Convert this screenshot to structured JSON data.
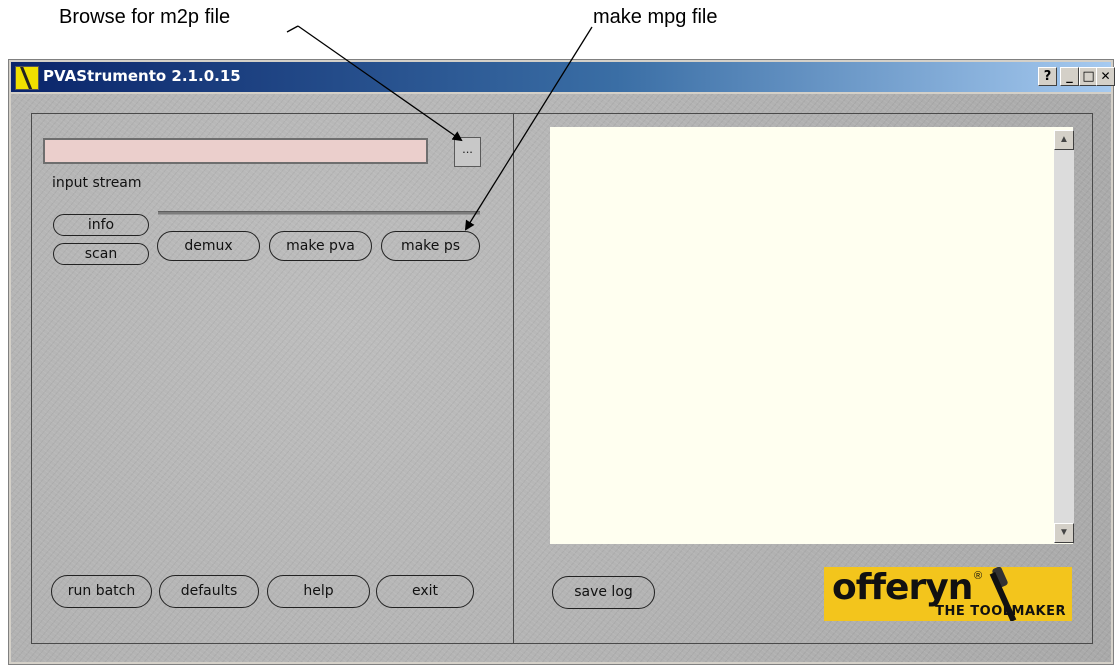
{
  "annotations": {
    "browse_note": "Browse for m2p file",
    "make_mpg_note": "make mpg file"
  },
  "window": {
    "title": "PVAStrumento 2.1.0.15",
    "help_btn": "?",
    "minimize_btn": "_",
    "maximize_btn": "□",
    "close_btn": "✕"
  },
  "left_panel": {
    "input_value": "",
    "browse_label": "...",
    "input_label": "input stream",
    "progress": 0,
    "buttons": {
      "info": "info",
      "scan": "scan",
      "demux": "demux",
      "make_pva": "make pva",
      "make_ps": "make ps",
      "run_batch": "run batch",
      "defaults": "defaults",
      "help": "help",
      "exit": "exit"
    }
  },
  "right_panel": {
    "log_text": "",
    "scroll_up": "▲",
    "scroll_down": "▼",
    "save_log": "save log",
    "logo": {
      "brand": "offeryn",
      "registered": "®",
      "tagline": "THE TOOLMAKER"
    }
  },
  "colors": {
    "input_bg": "#ebcfcc",
    "log_bg": "#fffff0",
    "logo_bg": "#f3c51c",
    "title_gradient_start": "#0a246a"
  }
}
